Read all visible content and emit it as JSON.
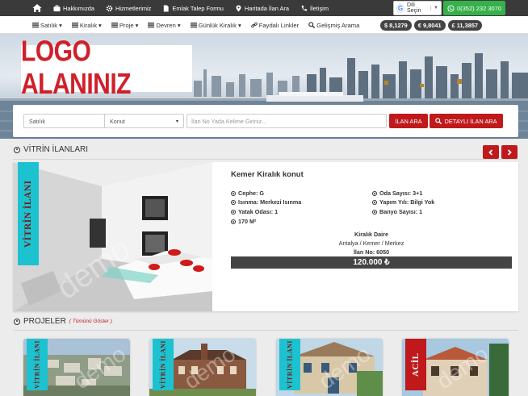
{
  "topbar": {
    "items": [
      "Hakkımızda",
      "Hizmetlerimiz",
      "Emlak Talep Formu",
      "Haritada İlan Ara",
      "İletişim"
    ],
    "language_label": "Dili Seçin",
    "phone": "0(352) 232 3070"
  },
  "nav2": {
    "items": [
      "Satılık",
      "Kiralık",
      "Proje",
      "Devren",
      "Günlük Kiralık",
      "Faydalı Linkler",
      "Gelişmiş Arama"
    ],
    "rates": [
      "$ 8,1279",
      "€ 9,8041",
      "£ 11,3857"
    ]
  },
  "logo": {
    "text": "LOGO ALANINIZ"
  },
  "search": {
    "type_value": "Satılık",
    "category_value": "Konut",
    "keyword_placeholder": "İlan No Yada Kelime Giriniz...",
    "search_label": "İLAN ARA",
    "detailed_label": "DETAYLI İLAN ARA"
  },
  "vitrin": {
    "heading": "VİTRİN İLANLARI",
    "ribbon": "VİTRİN İLANI",
    "watermark": "demo",
    "title": "Kemer Kiralık konut",
    "attrs_left": [
      "Cephe: G",
      "Isınma: Merkezi Isınma",
      "Yatak Odası: 1",
      "170 M²"
    ],
    "attrs_right": [
      "Oda Sayısı: 3+1",
      "Yapım Yılı: Bilgi Yok",
      "Banyo Sayısı: 1"
    ],
    "category": "Kiralık Daire",
    "location": "Antalya / Kemer / Merkez",
    "listing_no": "İlan No: 6050",
    "price": "120.000 ₺"
  },
  "projeler": {
    "heading": "PROJELER",
    "show_all": "( Tümünü Göster )",
    "cards": [
      {
        "ribbon": "VİTRİN İLANI",
        "ribbon_color": "#1cc2d0"
      },
      {
        "ribbon": "VİTRİN İLANI",
        "ribbon_color": "#1cc2d0"
      },
      {
        "ribbon": "VİTRİN İLANI",
        "ribbon_color": "#1cc2d0"
      },
      {
        "ribbon": "ACİL",
        "ribbon_color": "#c0191c"
      }
    ]
  },
  "colors": {
    "accent": "#c0191c",
    "topbar": "#3a3a3a",
    "whatsapp": "#36b04a",
    "ribbon": "#1cc2d0"
  }
}
